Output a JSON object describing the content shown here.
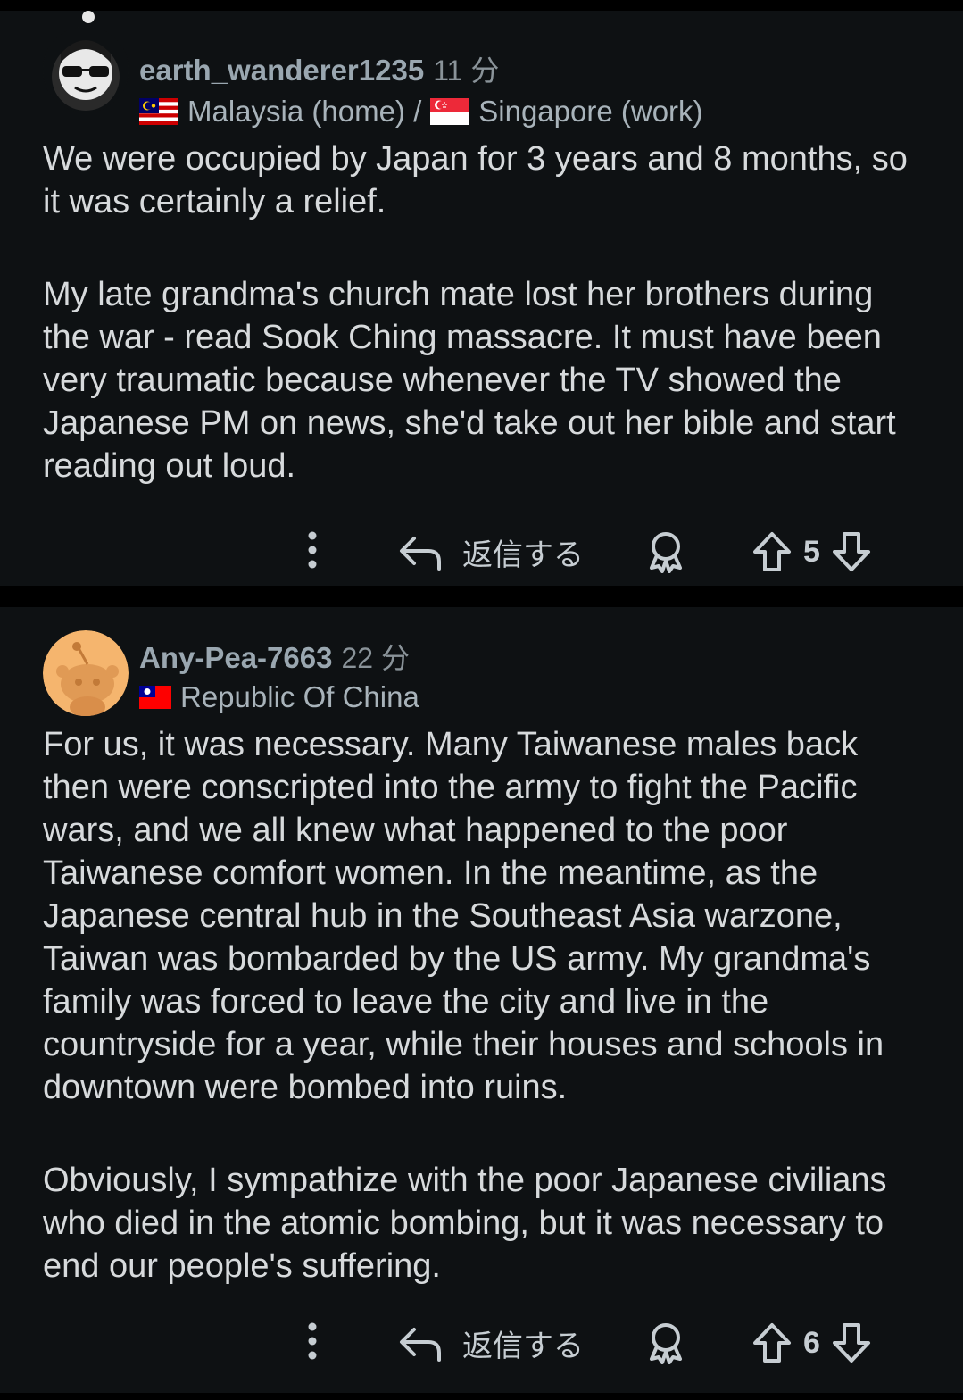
{
  "comments": [
    {
      "username": "earth_wanderer1235",
      "time": "11 分",
      "flair_parts": [
        "Malaysia (home) /",
        "Singapore (work)"
      ],
      "body": [
        "We were occupied by Japan for 3 years and 8 months, so it was certainly a relief.",
        "My late grandma's church mate lost her brothers during the war - read Sook Ching massacre. It must have been very traumatic because whenever the TV showed the Japanese PM on news, she'd take out her bible and start reading out loud."
      ],
      "reply_label": "返信する",
      "score": "5"
    },
    {
      "username": "Any-Pea-7663",
      "time": "22 分",
      "flair_parts": [
        "Republic Of China"
      ],
      "body": [
        "For us, it was necessary. Many Taiwanese males back then were conscripted into the army to fight the Pacific wars, and we all knew what happened to the poor Taiwanese comfort women. In the meantime, as the Japanese central hub in the Southeast Asia warzone, Taiwan was bombarded by the US army. My grandma's family was forced to leave the city and live in the countryside for a year, while their houses and schools in downtown were bombed into ruins.",
        "Obviously, I sympathize with the poor Japanese civilians who died in the atomic bombing, but it was necessary to end our people's suffering."
      ],
      "reply_label": "返信する",
      "score": "6"
    }
  ],
  "colors": {
    "background": "#0e1113",
    "separator": "#000000",
    "text": "#d7dadc",
    "username": "#9aa7b0"
  },
  "icons": [
    "more-options-icon",
    "reply-icon",
    "award-icon",
    "upvote-icon",
    "downvote-icon"
  ]
}
